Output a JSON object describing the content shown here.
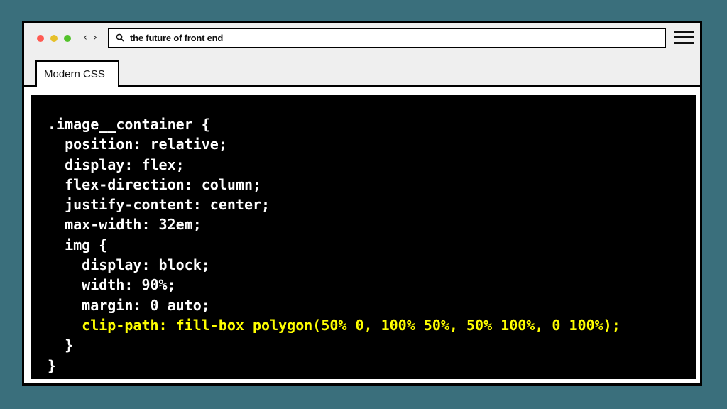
{
  "browser": {
    "nav": {
      "back_label": "‹",
      "forward_label": "›"
    },
    "address_bar": {
      "value": "the future of front end",
      "icon": "search-icon"
    },
    "menu_icon": "hamburger-menu-icon",
    "tab": {
      "label": "Modern CSS"
    },
    "window_controls": {
      "colors": [
        "#ff5a52",
        "#e6c02a",
        "#53c22b"
      ]
    }
  },
  "code": {
    "highlight_color": "#ffff00",
    "lines": [
      {
        "text": ".image__container {",
        "highlight": false
      },
      {
        "text": "  position: relative;",
        "highlight": false
      },
      {
        "text": "  display: flex;",
        "highlight": false
      },
      {
        "text": "  flex-direction: column;",
        "highlight": false
      },
      {
        "text": "  justify-content: center;",
        "highlight": false
      },
      {
        "text": "  max-width: 32em;",
        "highlight": false
      },
      {
        "text": "  img {",
        "highlight": false
      },
      {
        "text": "    display: block;",
        "highlight": false
      },
      {
        "text": "    width: 90%;",
        "highlight": false
      },
      {
        "text": "    margin: 0 auto;",
        "highlight": false
      },
      {
        "text": "    clip-path: fill-box polygon(50% 0, 100% 50%, 50% 100%, 0 100%);",
        "highlight": true
      },
      {
        "text": "  }",
        "highlight": false
      },
      {
        "text": "}",
        "highlight": false
      }
    ]
  }
}
